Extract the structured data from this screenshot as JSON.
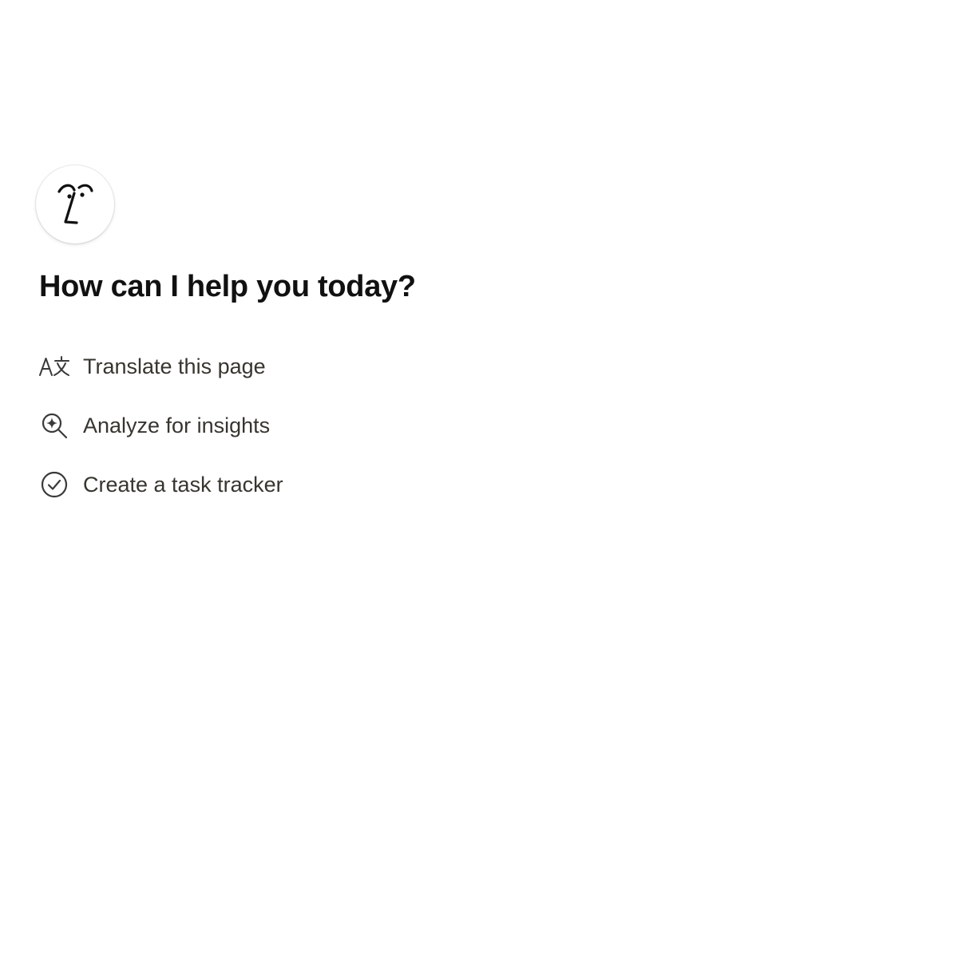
{
  "assistant": {
    "avatar_icon": "ai-face-icon"
  },
  "greeting": "How can I help you today?",
  "suggestions": [
    {
      "label": "Translate this page",
      "icon": "translate-icon"
    },
    {
      "label": "Analyze for insights",
      "icon": "search-sparkle-icon"
    },
    {
      "label": "Create a task tracker",
      "icon": "check-circle-icon"
    }
  ],
  "colors": {
    "text_primary": "#111111",
    "text_secondary": "#37352f",
    "icon": "#3a3a3a",
    "background": "#ffffff"
  }
}
